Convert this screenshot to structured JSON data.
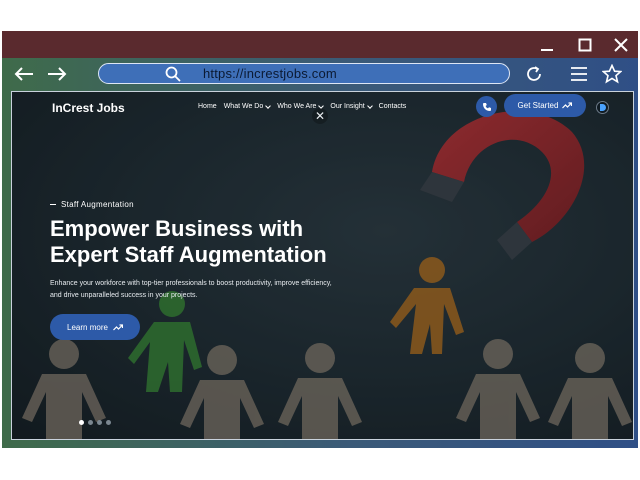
{
  "browser": {
    "url": "https://increstjobs.com",
    "icons": {
      "back": "arrow-left-icon",
      "forward": "arrow-right-icon",
      "search": "search-icon",
      "reload": "reload-icon",
      "menu": "hamburger-icon",
      "favorite": "star-icon",
      "minimize": "minimize-icon",
      "maximize": "maximize-icon",
      "close": "close-icon"
    }
  },
  "site": {
    "logo": "InCrest Jobs",
    "nav": [
      {
        "label": "Home",
        "has_dropdown": false
      },
      {
        "label": "What We Do",
        "has_dropdown": true
      },
      {
        "label": "Who We Are",
        "has_dropdown": true
      },
      {
        "label": "Our Insight",
        "has_dropdown": true
      },
      {
        "label": "Contacts",
        "has_dropdown": false
      }
    ],
    "cta_label": "Get Started",
    "overlay_close": "✕"
  },
  "hero": {
    "eyebrow": "Staff Augmentation",
    "headline_line1": "Empower Business with",
    "headline_line2": "Expert Staff Augmentation",
    "subtext_line1": "Enhance your workforce with top-tier professionals to boost productivity, improve efficiency,",
    "subtext_line2": "and drive unparalleled success in your projects.",
    "button_label": "Learn more",
    "slides_total": 4,
    "slide_active": 1
  },
  "colors": {
    "accent": "#2d5aa8",
    "titlebar": "#5a2a2e",
    "figure_beige": "#9c8d7e",
    "figure_green": "#3f8a3a",
    "figure_orange": "#c1761e",
    "magnet_red": "#a32b2f"
  }
}
